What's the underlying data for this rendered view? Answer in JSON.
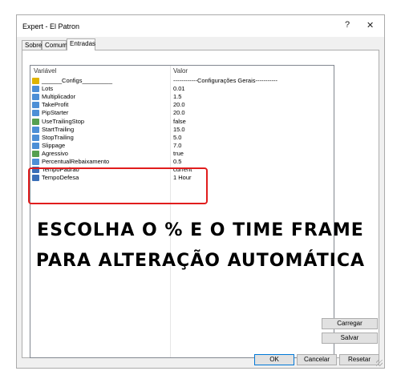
{
  "window": {
    "title": "Expert - El Patron",
    "help": "?",
    "close": "✕"
  },
  "tabs": [
    {
      "label": "Sobre"
    },
    {
      "label": "Comum"
    },
    {
      "label": "Entradas"
    }
  ],
  "grid": {
    "headers": {
      "name": "Variável",
      "value": "Valor"
    },
    "rows": [
      {
        "icon": "text-icon",
        "name": "______Configs_________",
        "value": "------------Configurações Gerais-----------"
      },
      {
        "icon": "number-icon",
        "name": "Lots",
        "value": "0.01"
      },
      {
        "icon": "number-icon",
        "name": "Multiplicador",
        "value": "1.5"
      },
      {
        "icon": "number-icon",
        "name": "TakeProfit",
        "value": "20.0"
      },
      {
        "icon": "number-icon",
        "name": "PipStarter",
        "value": "20.0"
      },
      {
        "icon": "boolean-icon",
        "name": "UseTrailingStop",
        "value": "false"
      },
      {
        "icon": "number-icon",
        "name": "StartTrailing",
        "value": "15.0"
      },
      {
        "icon": "number-icon",
        "name": "StopTrailing",
        "value": "5.0"
      },
      {
        "icon": "number-icon",
        "name": "Slippage",
        "value": "7.0"
      },
      {
        "icon": "boolean-icon",
        "name": "Agressivo",
        "value": "true"
      },
      {
        "icon": "number-icon",
        "name": "PercentualRebaixamento",
        "value": "0.5"
      },
      {
        "icon": "enum-icon",
        "name": "TempoPadrao",
        "value": "current"
      },
      {
        "icon": "enum-icon",
        "name": "TempoDefesa",
        "value": "1 Hour"
      }
    ]
  },
  "annotation": {
    "line1": "ESCOLHA O % E O TIME FRAME",
    "line2": "PARA ALTERAÇÃO AUTOMÁTICA",
    "color": "#e11d1d"
  },
  "buttons": {
    "carregar": "Carregar",
    "salvar": "Salvar",
    "ok": "OK",
    "cancelar": "Cancelar",
    "resetar": "Resetar"
  }
}
